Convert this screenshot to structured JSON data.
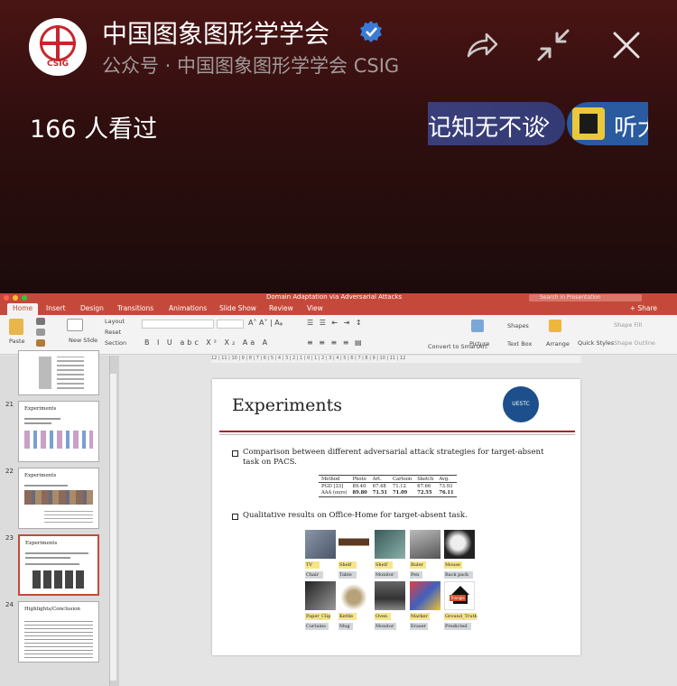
{
  "header": {
    "account_name": "中国图象图形学学会",
    "account_sub": "公众号 · 中国图象图形学学会 CSIG",
    "logo_text": "CSIG",
    "viewed": "166 人看过",
    "link1": "记知无不谈",
    "link2": "听大",
    "icons": [
      "verified-icon",
      "share-icon",
      "minimize-icon",
      "close-icon",
      "chevron-right-icon"
    ]
  },
  "ppt": {
    "window_title": "Domain Adaptation via Adversarial Attacks",
    "search_placeholder": "Search in Presentation",
    "tabs": [
      "Home",
      "Insert",
      "Design",
      "Transitions",
      "Animations",
      "Slide Show",
      "Review",
      "View"
    ],
    "share": "+ Share",
    "ribbon": {
      "paste": "Paste",
      "new_slide": "New Slide",
      "layout": "Layout",
      "reset": "Reset",
      "section": "Section",
      "convert": "Convert to SmartArt",
      "picture": "Picture",
      "shapes": "Shapes",
      "text_box": "Text Box",
      "arrange": "Arrange",
      "quick_styles": "Quick Styles",
      "shape_fill": "Shape Fill",
      "shape_outline": "Shape Outline"
    },
    "ruler": "12 | 11 | 10 | 9 | 8 | 7 | 6 | 5 | 4 | 3 | 2 | 1 | 0 | 1 | 2 | 3 | 4 | 5 | 6 | 7 | 8 | 9 | 10 | 11 | 12",
    "thumbnails": [
      {
        "num": "",
        "title": ""
      },
      {
        "num": "21",
        "title": "Experiments"
      },
      {
        "num": "22",
        "title": "Experiments"
      },
      {
        "num": "23",
        "title": "Experiments"
      },
      {
        "num": "24",
        "title": "Highlights/Conclusion"
      }
    ],
    "slide": {
      "title": "Experiments",
      "logo_text": "UESTC",
      "bullet1": "Comparison between different adversarial attack strategies for target-absent task on PACS.",
      "bullet2": "Qualitative results on Office-Home for target-absent task.",
      "table": {
        "header": [
          "Method",
          "Photo",
          "Art.",
          "Cartoon",
          "Sketch",
          "Avg."
        ],
        "rows": [
          [
            "PGD [33]",
            "89.40",
            "67.48",
            "71.12",
            "67.66",
            "73.93"
          ],
          [
            "AAA (ours)",
            "89.80",
            "71.51",
            "71.09",
            "72.55",
            "76.11"
          ]
        ]
      },
      "grid": [
        {
          "top": "TV",
          "bottom": "Chair"
        },
        {
          "top": "Shelf",
          "bottom": "Table"
        },
        {
          "top": "Shelf",
          "bottom": "Monitor"
        },
        {
          "top": "Ruler",
          "bottom": "Pen"
        },
        {
          "top": "Mouse",
          "bottom": "Back pack"
        },
        {
          "top": "Paper_Clip",
          "bottom": "Curtains"
        },
        {
          "top": "Kettle",
          "bottom": "Mug"
        },
        {
          "top": "Oven",
          "bottom": "Monitor"
        },
        {
          "top": "Marker",
          "bottom": "Eraser"
        },
        {
          "top": "Ground_Truth",
          "bottom": "Predicted"
        }
      ],
      "image_label": "Triangle"
    }
  }
}
